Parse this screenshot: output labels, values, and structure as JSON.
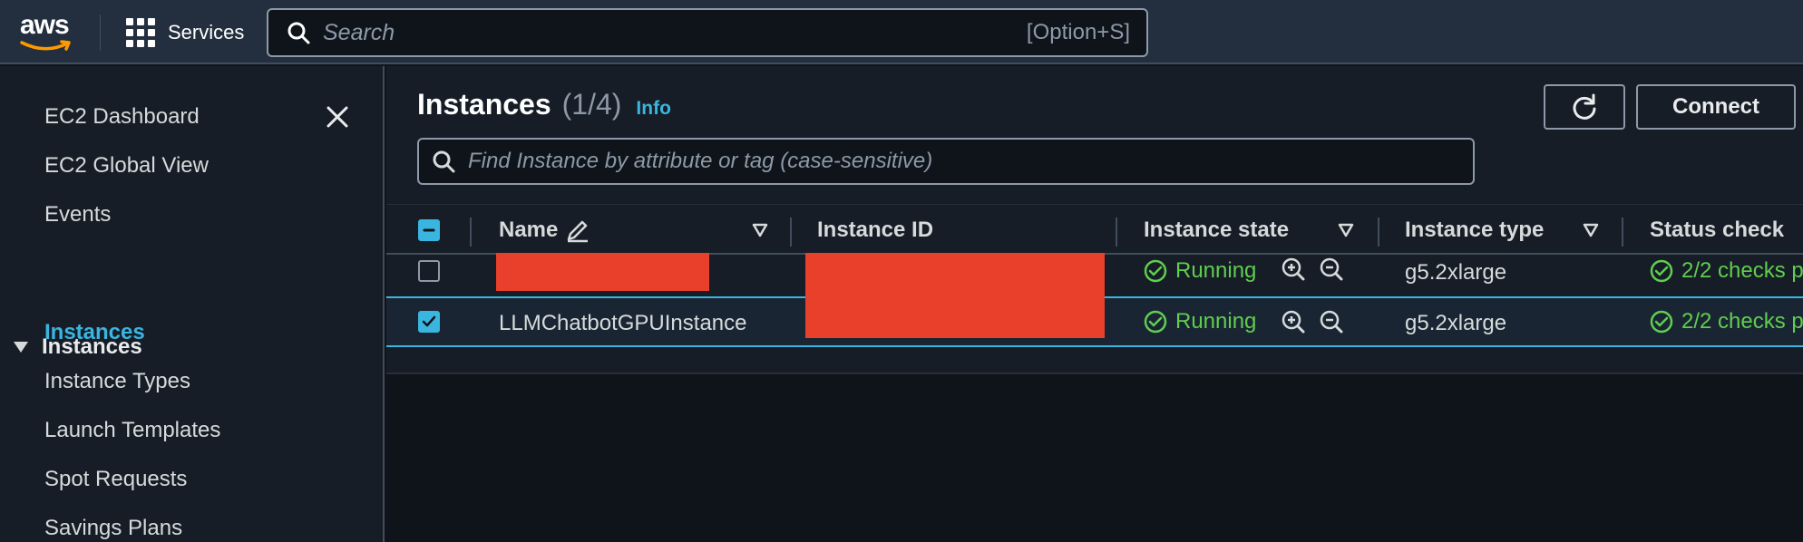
{
  "topnav": {
    "logo_text": "aws",
    "services_label": "Services",
    "search_placeholder": "Search",
    "search_shortcut": "[Option+S]"
  },
  "sidebar": {
    "items_top": [
      {
        "label": "EC2 Dashboard"
      },
      {
        "label": "EC2 Global View"
      },
      {
        "label": "Events"
      }
    ],
    "section": {
      "label": "Instances",
      "expanded": true
    },
    "section_items": [
      {
        "label": "Instances",
        "active": true
      },
      {
        "label": "Instance Types"
      },
      {
        "label": "Launch Templates"
      },
      {
        "label": "Spot Requests"
      },
      {
        "label": "Savings Plans"
      }
    ]
  },
  "main": {
    "title": "Instances",
    "count": "(1/4)",
    "info_link": "Info",
    "refresh_icon": "refresh-icon",
    "connect_label": "Connect",
    "filter_placeholder": "Find Instance by attribute or tag (case-sensitive)"
  },
  "table": {
    "headers": {
      "name": "Name",
      "instance_id": "Instance ID",
      "instance_state": "Instance state",
      "instance_type": "Instance type",
      "status_check": "Status check"
    },
    "rows": [
      {
        "name": "",
        "instance_id": "",
        "state": "Running",
        "type": "g5.2xlarge",
        "status": "2/2 checks p",
        "selected": false,
        "redacted": true
      },
      {
        "name": "LLMChatbotGPUInstance",
        "instance_id": "",
        "state": "Running",
        "type": "g5.2xlarge",
        "status": "2/2 checks p",
        "selected": true,
        "redacted_id": true
      }
    ]
  },
  "colors": {
    "accent": "#39b5e0",
    "running": "#5fce4f",
    "redaction": "#e8402a",
    "nav_bg": "#232f3e"
  }
}
